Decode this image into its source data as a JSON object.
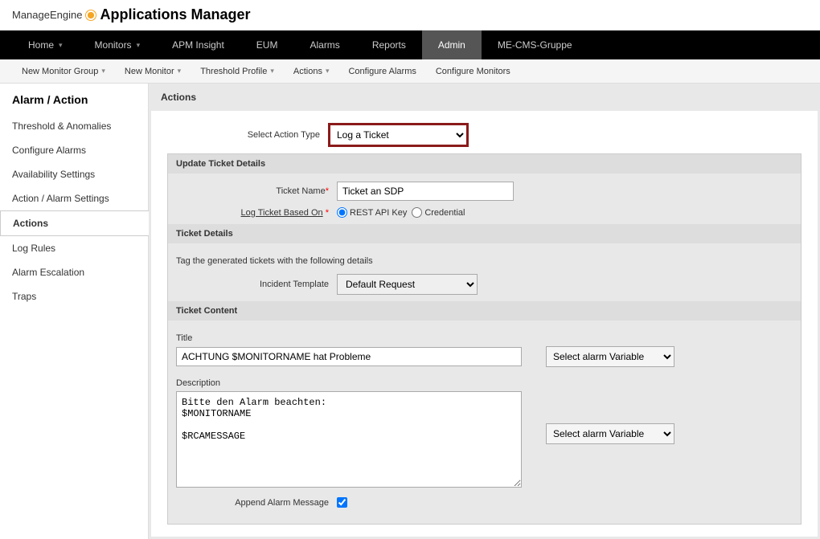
{
  "brand": {
    "text1": "ManageEngine",
    "text2": "Applications Manager"
  },
  "navPrimary": {
    "items": [
      {
        "label": "Home",
        "chev": true
      },
      {
        "label": "Monitors",
        "chev": true
      },
      {
        "label": "APM Insight"
      },
      {
        "label": "EUM"
      },
      {
        "label": "Alarms"
      },
      {
        "label": "Reports"
      },
      {
        "label": "Admin",
        "active": true
      },
      {
        "label": "ME-CMS-Gruppe"
      }
    ]
  },
  "navSecondary": {
    "items": [
      {
        "label": "New Monitor Group",
        "chev": true
      },
      {
        "label": "New Monitor",
        "chev": true
      },
      {
        "label": "Threshold Profile",
        "chev": true
      },
      {
        "label": "Actions",
        "chev": true
      },
      {
        "label": "Configure Alarms"
      },
      {
        "label": "Configure Monitors"
      }
    ]
  },
  "sidebar": {
    "title": "Alarm / Action",
    "items": [
      {
        "label": "Threshold & Anomalies"
      },
      {
        "label": "Configure Alarms"
      },
      {
        "label": "Availability Settings"
      },
      {
        "label": "Action / Alarm Settings"
      },
      {
        "label": "Actions",
        "active": true
      },
      {
        "label": "Log Rules"
      },
      {
        "label": "Alarm Escalation"
      },
      {
        "label": "Traps"
      }
    ]
  },
  "content": {
    "title": "Actions",
    "selectActionTypeLabel": "Select Action Type",
    "selectActionTypeValue": "Log a Ticket",
    "updateTicketDetails": "Update Ticket Details",
    "ticketNameLabel": "Ticket Name",
    "ticketNameValue": "Ticket an SDP",
    "logTicketBasedOnLabel": "Log Ticket Based On",
    "radioRest": "REST API Key",
    "radioCred": "Credential",
    "ticketDetailsHeader": "Ticket Details",
    "tagLine": "Tag the generated tickets with the following details",
    "incidentTemplateLabel": "Incident Template",
    "incidentTemplateValue": "Default Request",
    "ticketContentHeader": "Ticket Content",
    "titleLabel": "Title",
    "titleValue": "ACHTUNG $MONITORNAME hat Probleme",
    "selectAlarmVar": "Select alarm Variable",
    "descriptionLabel": "Description",
    "descriptionValue": "Bitte den Alarm beachten:\n$MONITORNAME\n\n$RCAMESSAGE",
    "appendAlarmLabel": "Append Alarm Message"
  }
}
